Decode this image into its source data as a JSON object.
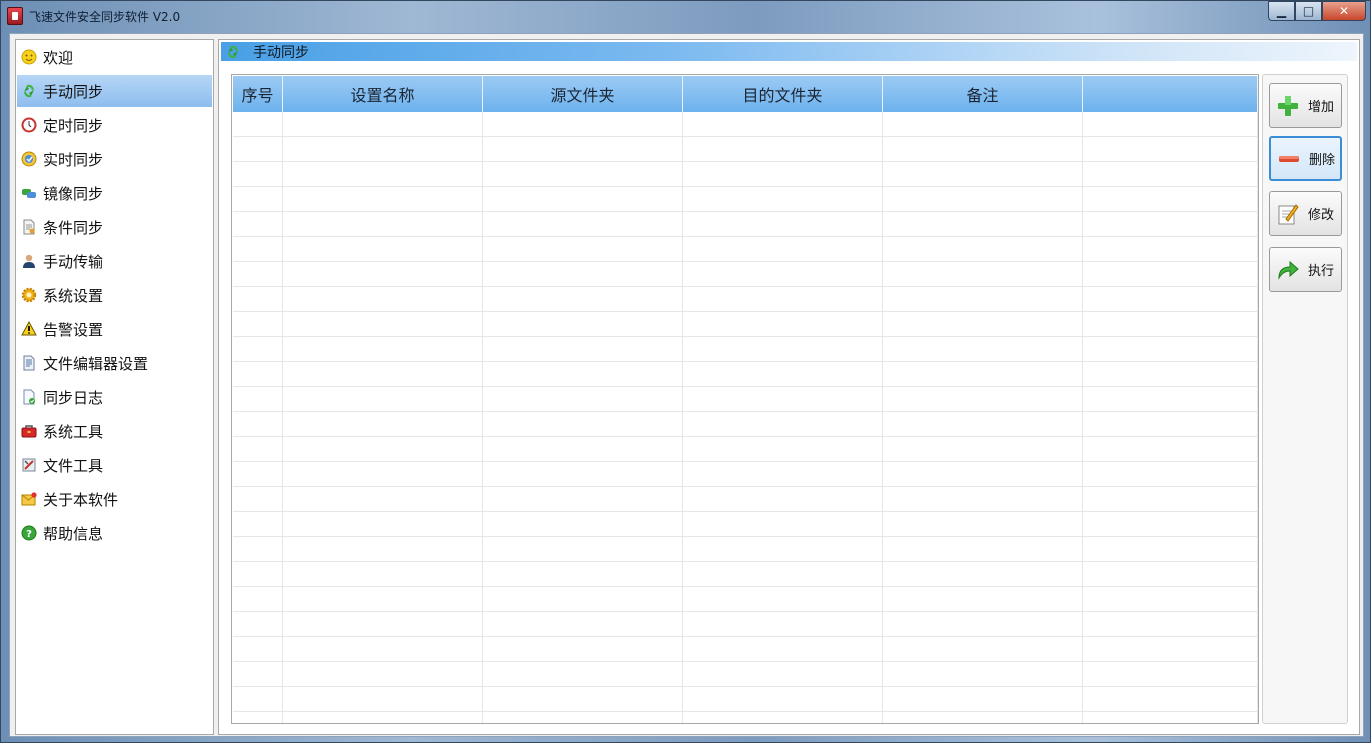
{
  "window": {
    "title": "飞速文件安全同步软件 V2.0",
    "controls": {
      "minimize": "▁",
      "maximize": "□",
      "close": "✕"
    }
  },
  "sidebar": {
    "selected_index": 1,
    "items": [
      {
        "label": "欢迎",
        "icon": "smiley-icon"
      },
      {
        "label": "手动同步",
        "icon": "sync-arrows-icon"
      },
      {
        "label": "定时同步",
        "icon": "clock-icon"
      },
      {
        "label": "实时同步",
        "icon": "realtime-sync-icon"
      },
      {
        "label": "镜像同步",
        "icon": "mirror-icon"
      },
      {
        "label": "条件同步",
        "icon": "condition-document-icon"
      },
      {
        "label": "手动传输",
        "icon": "user-icon"
      },
      {
        "label": "系统设置",
        "icon": "gear-icon"
      },
      {
        "label": "告警设置",
        "icon": "warning-icon"
      },
      {
        "label": "文件编辑器设置",
        "icon": "file-editor-icon"
      },
      {
        "label": "同步日志",
        "icon": "log-document-icon"
      },
      {
        "label": "系统工具",
        "icon": "toolbox-icon"
      },
      {
        "label": "文件工具",
        "icon": "file-tool-icon"
      },
      {
        "label": "关于本软件",
        "icon": "about-envelope-icon"
      },
      {
        "label": "帮助信息",
        "icon": "help-icon"
      }
    ]
  },
  "main": {
    "header": {
      "title": "手动同步",
      "icon": "sync-arrows-icon"
    },
    "table": {
      "columns": [
        "序号",
        "设置名称",
        "源文件夹",
        "目的文件夹",
        "备注",
        ""
      ],
      "rows": []
    }
  },
  "actions": [
    {
      "label": "增加",
      "icon": "plus-icon",
      "focused": false
    },
    {
      "label": "删除",
      "icon": "minus-icon",
      "focused": true
    },
    {
      "label": "修改",
      "icon": "edit-icon",
      "focused": false
    },
    {
      "label": "执行",
      "icon": "execute-arrow-icon",
      "focused": false
    }
  ],
  "colors": {
    "selection": "#8dbdee",
    "header_gradient_start": "#4aa0e6",
    "table_header": "#6db2ee",
    "focus_border": "#3b8ed6"
  }
}
